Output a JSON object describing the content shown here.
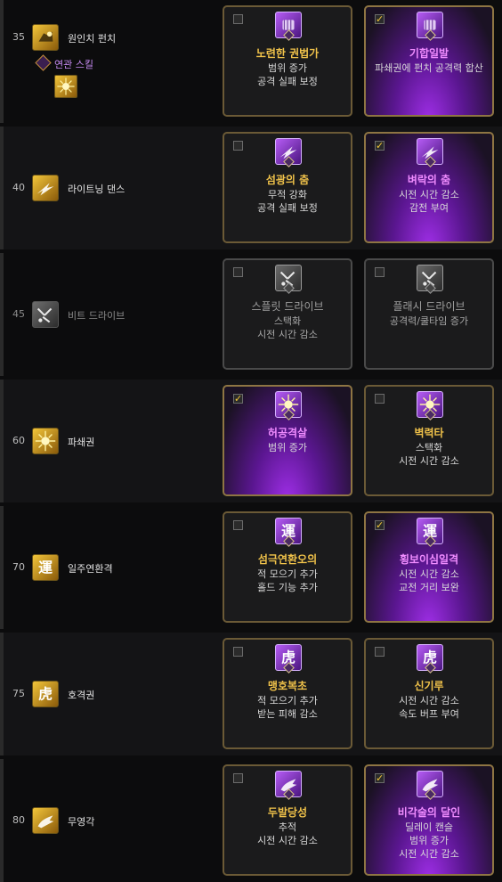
{
  "colors": {
    "gold": "#f0c24a",
    "selected_title": "#f08cff",
    "related_text": "#c98cf5"
  },
  "rows": [
    {
      "level": "35",
      "name": "원인치 펀치",
      "icon": "punch-icon",
      "enabled": true,
      "related_label": "연관 스킬",
      "options": [
        {
          "checked": false,
          "title": "노련한 권법가",
          "desc": [
            "범위 증가",
            "공격 실패 보정"
          ],
          "icon": "fist-icon"
        },
        {
          "checked": true,
          "title": "기합일발",
          "desc": [
            "파쇄권에 펀치 공격력 합산"
          ],
          "icon": "fist-icon"
        }
      ]
    },
    {
      "level": "40",
      "name": "라이트닝 댄스",
      "icon": "lightning-dash-icon",
      "enabled": true,
      "options": [
        {
          "checked": false,
          "title": "섬광의 춤",
          "desc": [
            "무적 강화",
            "공격 실패 보정"
          ],
          "icon": "lightning-dash-icon"
        },
        {
          "checked": true,
          "title": "벼락의 춤",
          "desc": [
            "시전 시간 감소",
            "감전 부여"
          ],
          "icon": "lightning-dash-icon"
        }
      ]
    },
    {
      "level": "45",
      "name": "비트 드라이브",
      "icon": "beat-drive-icon",
      "enabled": false,
      "options": [
        {
          "checked": false,
          "title": "스플릿 드라이브",
          "desc": [
            "스택화",
            "시전 시간 감소"
          ],
          "icon": "beat-drive-icon"
        },
        {
          "checked": false,
          "title": "플래시 드라이브",
          "desc": [
            "공격력/쿨타임 증가"
          ],
          "icon": "beat-drive-icon"
        }
      ]
    },
    {
      "level": "60",
      "name": "파쇄권",
      "icon": "burst-icon",
      "enabled": true,
      "options": [
        {
          "checked": true,
          "title": "허공격살",
          "desc": [
            "범위 증가"
          ],
          "icon": "burst-icon"
        },
        {
          "checked": false,
          "title": "벽력타",
          "desc": [
            "스택화",
            "시전 시간 감소"
          ],
          "icon": "burst-icon"
        }
      ]
    },
    {
      "level": "70",
      "name": "일주연환격",
      "icon": "chain-glyph-icon",
      "enabled": true,
      "options": [
        {
          "checked": false,
          "title": "섬극연환오의",
          "desc": [
            "적 모으기 추가",
            "홀드 기능 추가"
          ],
          "icon": "chain-glyph-icon"
        },
        {
          "checked": true,
          "title": "횡보이심일격",
          "desc": [
            "시전 시간 감소",
            "교전 거리 보완"
          ],
          "icon": "chain-glyph-icon"
        }
      ]
    },
    {
      "level": "75",
      "name": "호격권",
      "icon": "tiger-glyph-icon",
      "enabled": true,
      "options": [
        {
          "checked": false,
          "title": "맹호복초",
          "desc": [
            "적 모으기 추가",
            "받는 피해 감소"
          ],
          "icon": "tiger-glyph-icon"
        },
        {
          "checked": false,
          "title": "신기루",
          "desc": [
            "시전 시간 감소",
            "속도 버프 부여"
          ],
          "icon": "tiger-glyph-icon"
        }
      ]
    },
    {
      "level": "80",
      "name": "무영각",
      "icon": "shadow-kick-icon",
      "enabled": true,
      "options": [
        {
          "checked": false,
          "title": "두발당성",
          "desc": [
            "추적",
            "시전 시간 감소"
          ],
          "icon": "shadow-kick-icon"
        },
        {
          "checked": true,
          "title": "비각술의 달인",
          "desc": [
            "딜레이 캔슬",
            "범위 증가",
            "시전 시간 감소"
          ],
          "icon": "shadow-kick-icon"
        }
      ]
    }
  ]
}
